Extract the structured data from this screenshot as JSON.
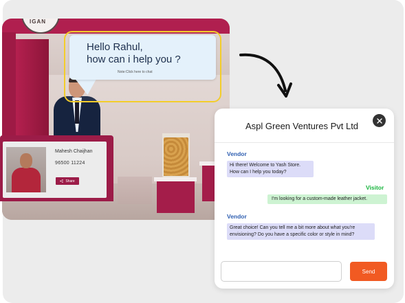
{
  "booth": {
    "logo_text": "IGAN",
    "vendor_card": {
      "name": "Mahesh Chaijhan",
      "phone": "96500 11224",
      "share_label": "Share"
    }
  },
  "greeting": {
    "line1": "Hello Rahul,",
    "line2": "how can i help you ?",
    "note": "Note:Click here to chat"
  },
  "chat": {
    "title": "Aspl Green Ventures Pvt Ltd",
    "messages": [
      {
        "sender": "Vendor",
        "text": "Hi there! Welcome to Yash Store. How can I help you today?"
      },
      {
        "sender": "Visitor",
        "text": "I'm looking for a custom-made leather jacket."
      },
      {
        "sender": "Vendor",
        "text": "Great choice! Can you tell me a bit more about what you're envisioning? Do you have a specific color or style in mind?"
      }
    ],
    "input_value": "",
    "send_label": "Send"
  },
  "colors": {
    "booth_accent": "#9c1c48",
    "highlight_frame": "#f3cd2a",
    "vendor_label": "#2f5fb1",
    "visitor_label": "#18b43d",
    "send_button": "#f15a22"
  },
  "icons": [
    "share-icon",
    "close-icon",
    "curved-arrow-icon"
  ]
}
